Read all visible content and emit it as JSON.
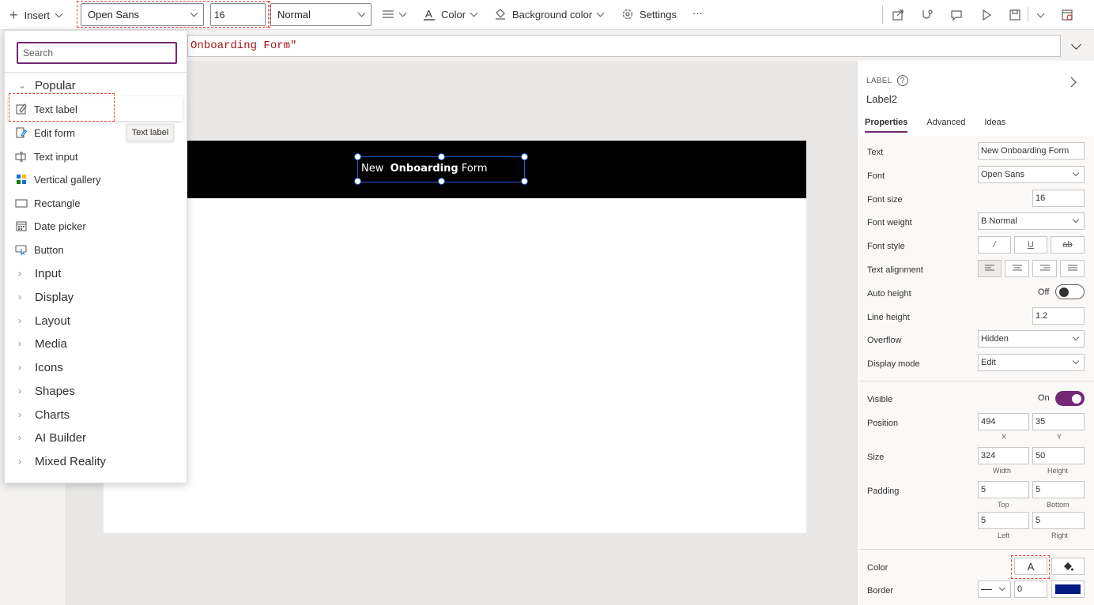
{
  "toolbar": {
    "insert_label": "Insert",
    "font_family": "Open Sans",
    "font_size": "16",
    "font_weight": "Normal",
    "color_label": "Color",
    "background_color_label": "Background color",
    "settings_label": "Settings",
    "more_label": "···"
  },
  "formula_bar": {
    "value": "Onboarding Form\""
  },
  "insert_panel": {
    "search_placeholder": "Search",
    "popular_label": "Popular",
    "popular_items": [
      {
        "label": "Text label",
        "icon": "text-label-icon"
      },
      {
        "label": "Edit form",
        "icon": "edit-form-icon"
      },
      {
        "label": "Text input",
        "icon": "text-input-icon"
      },
      {
        "label": "Vertical gallery",
        "icon": "vertical-gallery-icon"
      },
      {
        "label": "Rectangle",
        "icon": "rectangle-icon"
      },
      {
        "label": "Date picker",
        "icon": "calendar-icon"
      },
      {
        "label": "Button",
        "icon": "button-icon"
      }
    ],
    "categories": [
      "Input",
      "Display",
      "Layout",
      "Media",
      "Icons",
      "Shapes",
      "Charts",
      "AI Builder",
      "Mixed Reality"
    ],
    "tooltip": "Text label"
  },
  "canvas": {
    "label_text_normal": "New",
    "label_text_bold": "Onboarding",
    "label_text_tail": "Form",
    "header_color": "#000000",
    "selection_color": "#1f5ed8"
  },
  "properties": {
    "kind": "LABEL",
    "name": "Label2",
    "tabs": [
      "Properties",
      "Advanced",
      "Ideas"
    ],
    "active_tab": "Properties",
    "text_label": "Text",
    "text_value": "New  Onboarding Form",
    "font_label": "Font",
    "font_value": "Open Sans",
    "font_size_label": "Font size",
    "font_size_value": "16",
    "font_weight_label": "Font weight",
    "font_weight_value": "B  Normal",
    "font_style_label": "Font style",
    "text_alignment_label": "Text alignment",
    "auto_height_label": "Auto height",
    "auto_height_value": "Off",
    "line_height_label": "Line height",
    "line_height_value": "1.2",
    "overflow_label": "Overflow",
    "overflow_value": "Hidden",
    "display_mode_label": "Display mode",
    "display_mode_value": "Edit",
    "visible_label": "Visible",
    "visible_value": "On",
    "position_label": "Position",
    "position_x": "494",
    "position_y": "35",
    "x_label": "X",
    "y_label": "Y",
    "size_label": "Size",
    "width_value": "324",
    "height_value": "50",
    "width_label": "Width",
    "height_label": "Height",
    "padding_label": "Padding",
    "padding_top": "5",
    "padding_bottom": "5",
    "padding_left": "5",
    "padding_right": "5",
    "top_label": "Top",
    "bottom_label": "Bottom",
    "left_label": "Left",
    "right_label": "Right",
    "color_label": "Color",
    "color_button": "A",
    "border_label": "Border",
    "border_width": "0",
    "border_color": "#001a80"
  },
  "colors": {
    "accent": "#742774",
    "highlight_dash": "#e04a3a"
  }
}
